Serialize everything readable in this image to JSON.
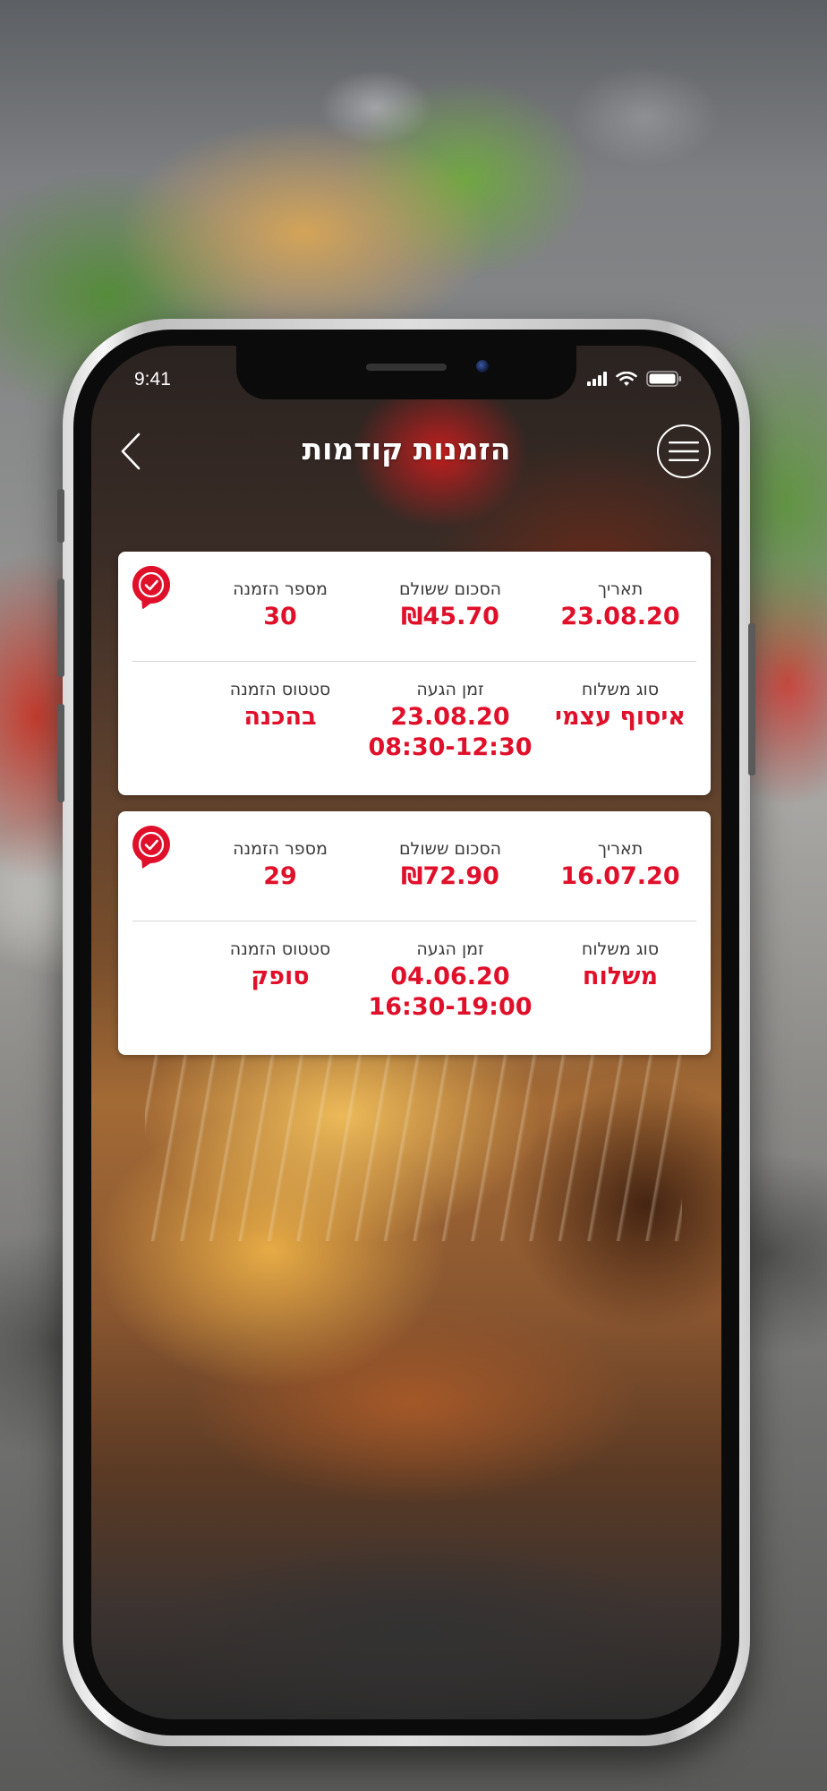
{
  "status": {
    "time": "9:41"
  },
  "header": {
    "title": "הזמנות קודמות"
  },
  "labels": {
    "date": "תאריך",
    "amount_paid": "הסכום ששולם",
    "order_number": "מספר הזמנה",
    "delivery_type": "סוג משלוח",
    "arrival_time": "זמן הגעה",
    "order_status": "סטטוס הזמנה"
  },
  "orders": [
    {
      "date": "23.08.20",
      "amount": "₪45.70",
      "order_number": "30",
      "delivery_type": "איסוף עצמי",
      "arrival_date": "23.08.20",
      "arrival_window": "08:30-12:30",
      "status": "בהכנה"
    },
    {
      "date": "16.07.20",
      "amount": "₪72.90",
      "order_number": "29",
      "delivery_type": "משלוח",
      "arrival_date": "04.06.20",
      "arrival_window": "16:30-19:00",
      "status": "סופק"
    }
  ],
  "colors": {
    "accent": "#e0102a",
    "card_bg": "#ffffff",
    "label_text": "#3a3a3a"
  },
  "icons": {
    "back": "chevron-left-icon",
    "menu": "hamburger-menu-icon",
    "badge": "check-badge-icon",
    "signal": "signal-icon",
    "wifi": "wifi-icon",
    "battery": "battery-icon"
  }
}
